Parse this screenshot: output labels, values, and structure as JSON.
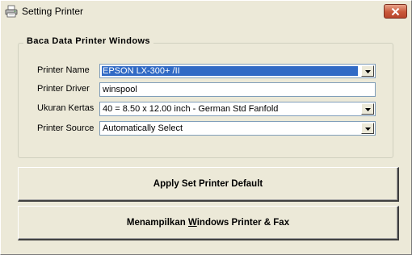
{
  "window": {
    "title": "Setting Printer"
  },
  "group": {
    "title": "Baca Data Printer Windows"
  },
  "fields": {
    "printer_name": {
      "label": "Printer Name",
      "value": "EPSON LX-300+ /II"
    },
    "printer_driver": {
      "label": "Printer Driver",
      "value": "winspool"
    },
    "paper_size": {
      "label": "Ukuran Kertas",
      "value": "40 = 8.50 x 12.00 inch - German Std Fanfold"
    },
    "printer_source": {
      "label": "Printer Source",
      "value": "Automatically Select"
    }
  },
  "buttons": {
    "apply_default": "Apply Set Printer Default",
    "show_printers_pre": "Menampilkan ",
    "show_printers_mnemonic": "W",
    "show_printers_post": "indows Printer & Fax"
  },
  "icons": {
    "app": "printer-icon",
    "close": "close-icon",
    "dropdown": "chevron-down-icon"
  },
  "colors": {
    "selection": "#316ac5",
    "close_button": "#c9583a"
  }
}
